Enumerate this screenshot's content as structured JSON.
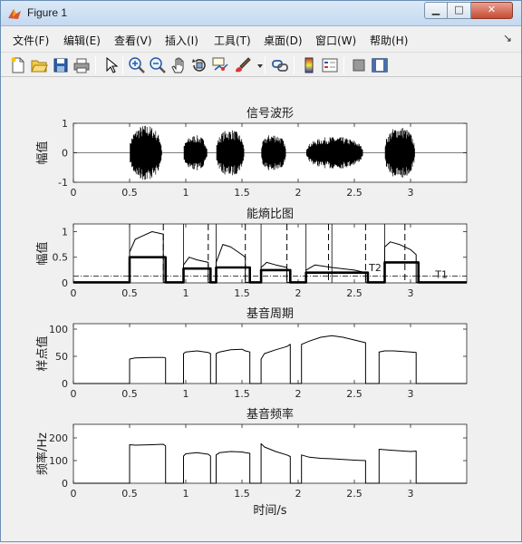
{
  "window": {
    "title": "Figure 1",
    "minimize_glyph": "▁",
    "maximize_glyph": "□",
    "close_glyph": "✕"
  },
  "menu": {
    "items": [
      "文件(F)",
      "编辑(E)",
      "查看(V)",
      "插入(I)",
      "工具(T)",
      "桌面(D)",
      "窗口(W)",
      "帮助(H)"
    ],
    "end_glyph": "↘"
  },
  "toolbar": {
    "icons": [
      "new-figure-icon",
      "open-folder-icon",
      "save-icon",
      "print-icon",
      "pointer-arrow-icon",
      "zoom-in-icon",
      "zoom-out-icon",
      "pan-hand-icon",
      "rotate-3d-icon",
      "data-cursor-icon",
      "brush-icon",
      "dropdown-arrow-icon",
      "link-plot-icon",
      "colorbar-icon",
      "legend-icon",
      "hide-plot-tools-icon",
      "show-plot-tools-icon"
    ]
  },
  "figure": {
    "xlabel": "时间/s",
    "line_color": "#000000",
    "axes_background": "#ffffff"
  },
  "chart_data": [
    {
      "type": "line",
      "title": "信号波形",
      "ylabel": "幅值",
      "xlim": [
        0,
        3.5
      ],
      "ylim": [
        -1,
        1
      ],
      "xticks": [
        "0",
        "0.5",
        "1",
        "1.5",
        "2",
        "2.5",
        "3"
      ],
      "yticks": [
        "-1",
        "0",
        "1"
      ],
      "segments": [
        {
          "start": 0.5,
          "end": 0.8,
          "amplitude": 0.95
        },
        {
          "start": 0.98,
          "end": 1.2,
          "amplitude": 0.6
        },
        {
          "start": 1.27,
          "end": 1.53,
          "amplitude": 0.8
        },
        {
          "start": 1.67,
          "end": 1.9,
          "amplitude": 0.65
        },
        {
          "start": 2.07,
          "end": 2.6,
          "amplitude": 0.55
        },
        {
          "start": 2.77,
          "end": 3.05,
          "amplitude": 0.9
        }
      ]
    },
    {
      "type": "line",
      "title": "能熵比图",
      "ylabel": "幅值",
      "xlim": [
        0,
        3.5
      ],
      "ylim": [
        0,
        1.15
      ],
      "xticks": [
        "0",
        "0.5",
        "1",
        "1.5",
        "2",
        "2.5",
        "3"
      ],
      "yticks": [
        "0",
        "0.5",
        "1"
      ],
      "series": [
        {
          "name": "",
          "x": [
            0,
            0.5,
            0.5,
            0.55,
            0.6,
            0.7,
            0.8,
            0.8,
            0.98,
            0.98,
            1.03,
            1.1,
            1.2,
            1.2,
            1.27,
            1.27,
            1.33,
            1.4,
            1.5,
            1.53,
            1.53,
            1.67,
            1.67,
            1.72,
            1.8,
            1.9,
            1.9,
            2.07,
            2.07,
            2.15,
            2.3,
            2.5,
            2.6,
            2.6,
            2.77,
            2.77,
            2.82,
            2.9,
            3.0,
            3.05,
            3.05,
            3.5
          ],
          "y": [
            0.01,
            0.01,
            0.6,
            0.85,
            0.9,
            1.0,
            0.95,
            0.01,
            0.01,
            0.35,
            0.5,
            0.45,
            0.4,
            0.01,
            0.01,
            0.4,
            0.75,
            0.7,
            0.55,
            0.5,
            0.01,
            0.01,
            0.3,
            0.4,
            0.35,
            0.3,
            0.01,
            0.01,
            0.25,
            0.35,
            0.3,
            0.25,
            0.2,
            0.01,
            0.01,
            0.7,
            0.8,
            0.75,
            0.65,
            0.55,
            0.01,
            0.01
          ]
        },
        {
          "name": "",
          "x": [
            0,
            0.5,
            0.5,
            0.82,
            0.82,
            0.98,
            0.98,
            1.22,
            1.22,
            1.27,
            1.27,
            1.57,
            1.57,
            1.67,
            1.67,
            1.93,
            1.93,
            2.07,
            2.07,
            2.62,
            2.62,
            2.77,
            2.77,
            3.07,
            3.07,
            3.5
          ],
          "y": [
            0.01,
            0.01,
            0.5,
            0.5,
            0.01,
            0.01,
            0.28,
            0.28,
            0.01,
            0.01,
            0.3,
            0.3,
            0.01,
            0.01,
            0.25,
            0.25,
            0.01,
            0.01,
            0.2,
            0.2,
            0.01,
            0.01,
            0.4,
            0.4,
            0.01,
            0.01
          ]
        }
      ],
      "thresholds": [
        {
          "label": "T1",
          "value": 0.13
        },
        {
          "label": "T2",
          "value": 0.3
        }
      ],
      "solid_markers": [
        0.5,
        0.98,
        1.27,
        1.67,
        2.07,
        2.3,
        2.77
      ],
      "dashed_markers": [
        0.8,
        1.2,
        1.53,
        1.9,
        2.27,
        2.6,
        2.95
      ]
    },
    {
      "type": "line",
      "title": "基音周期",
      "ylabel": "样点值",
      "xlim": [
        0,
        3.5
      ],
      "ylim": [
        0,
        110
      ],
      "xticks": [
        "0",
        "0.5",
        "1",
        "1.5",
        "2",
        "2.5",
        "3"
      ],
      "yticks": [
        "0",
        "50",
        "100"
      ],
      "series": [
        {
          "name": "",
          "x": [
            0,
            0.5,
            0.5,
            0.55,
            0.7,
            0.8,
            0.82,
            0.82,
            0.98,
            0.98,
            1.0,
            1.1,
            1.2,
            1.22,
            1.22,
            1.27,
            1.27,
            1.3,
            1.4,
            1.5,
            1.53,
            1.57,
            1.57,
            1.67,
            1.67,
            1.7,
            1.8,
            1.9,
            1.93,
            1.93,
            2.03,
            2.03,
            2.1,
            2.2,
            2.3,
            2.4,
            2.5,
            2.6,
            2.6,
            2.72,
            2.72,
            2.77,
            2.85,
            3.0,
            3.05,
            3.05,
            3.5
          ],
          "y": [
            0,
            0,
            45,
            47,
            48,
            48,
            47,
            0,
            0,
            55,
            58,
            60,
            57,
            55,
            0,
            0,
            55,
            58,
            62,
            63,
            60,
            58,
            0,
            0,
            45,
            55,
            62,
            68,
            72,
            0,
            0,
            72,
            78,
            85,
            88,
            85,
            80,
            75,
            0,
            0,
            58,
            60,
            60,
            58,
            57,
            0,
            0
          ]
        }
      ]
    },
    {
      "type": "line",
      "title": "基音频率",
      "ylabel": "频率/Hz",
      "xlabel": "时间/s",
      "xlim": [
        0,
        3.5
      ],
      "ylim": [
        0,
        260
      ],
      "xticks": [
        "0",
        "0.5",
        "1",
        "1.5",
        "2",
        "2.5",
        "3"
      ],
      "yticks": [
        "0",
        "100",
        "200"
      ],
      "series": [
        {
          "name": "",
          "x": [
            0,
            0.5,
            0.5,
            0.55,
            0.7,
            0.8,
            0.82,
            0.82,
            0.98,
            0.98,
            1.0,
            1.1,
            1.2,
            1.22,
            1.22,
            1.27,
            1.27,
            1.3,
            1.4,
            1.5,
            1.53,
            1.57,
            1.57,
            1.67,
            1.67,
            1.7,
            1.8,
            1.9,
            1.93,
            1.93,
            2.03,
            2.03,
            2.1,
            2.2,
            2.3,
            2.4,
            2.5,
            2.6,
            2.6,
            2.72,
            2.72,
            2.77,
            2.85,
            3.0,
            3.05,
            3.05,
            3.5
          ],
          "y": [
            0,
            0,
            170,
            168,
            170,
            172,
            165,
            0,
            0,
            120,
            130,
            135,
            128,
            120,
            0,
            0,
            125,
            135,
            140,
            138,
            135,
            132,
            0,
            0,
            175,
            160,
            140,
            125,
            118,
            0,
            0,
            125,
            115,
            110,
            108,
            105,
            102,
            100,
            0,
            0,
            150,
            148,
            145,
            140,
            142,
            0,
            0
          ]
        }
      ]
    }
  ]
}
